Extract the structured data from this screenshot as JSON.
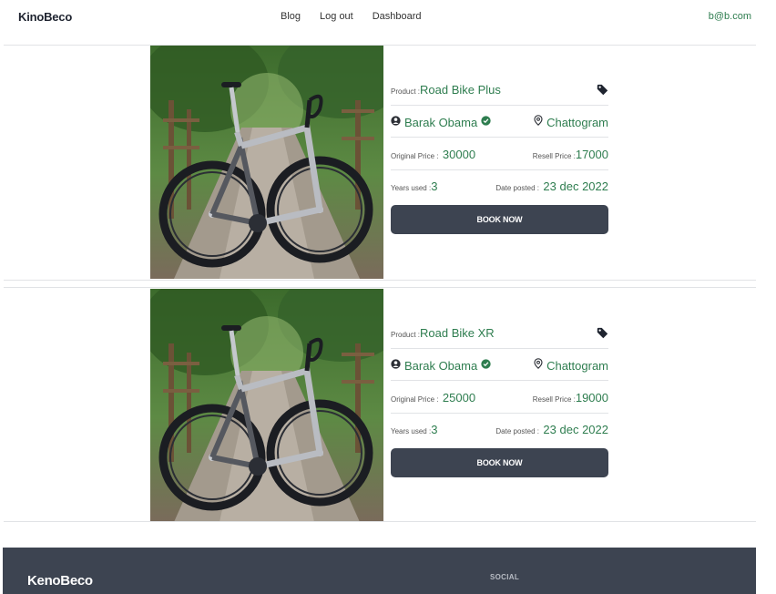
{
  "navbar": {
    "brand": "KinoBeco",
    "links": [
      "Blog",
      "Log out",
      "Dashboard"
    ],
    "user_email": "b@b.com"
  },
  "products": [
    {
      "product_label": "Product :",
      "name": "Road Bike Plus",
      "seller": "Barak Obama",
      "verified": true,
      "location": "Chattogram",
      "original_price_label": "Original Price :",
      "original_price": "30000",
      "resell_price_label": "Resell Price :",
      "resell_price": "17000",
      "years_used_label": "Years used :",
      "years_used": "3",
      "date_posted_label": "Date posted :",
      "date_posted": "23 dec 2022",
      "button_label": "BOOK NOW"
    },
    {
      "product_label": "Product :",
      "name": "Road Bike XR",
      "seller": "Barak Obama",
      "verified": true,
      "location": "Chattogram",
      "original_price_label": "Original Price :",
      "original_price": "25000",
      "resell_price_label": "Resell Price :",
      "resell_price": "19000",
      "years_used_label": "Years used :",
      "years_used": "3",
      "date_posted_label": "Date posted :",
      "date_posted": "23 dec 2022",
      "button_label": "BOOK NOW"
    }
  ],
  "footer": {
    "brand": "KenoBeco",
    "social_heading": "SOCIAL"
  },
  "colors": {
    "accent_green": "#2e7d4f",
    "button_dark": "#3d4451"
  },
  "icons": [
    "tag-icon",
    "user-icon",
    "verified-check-icon",
    "location-pin-icon"
  ]
}
